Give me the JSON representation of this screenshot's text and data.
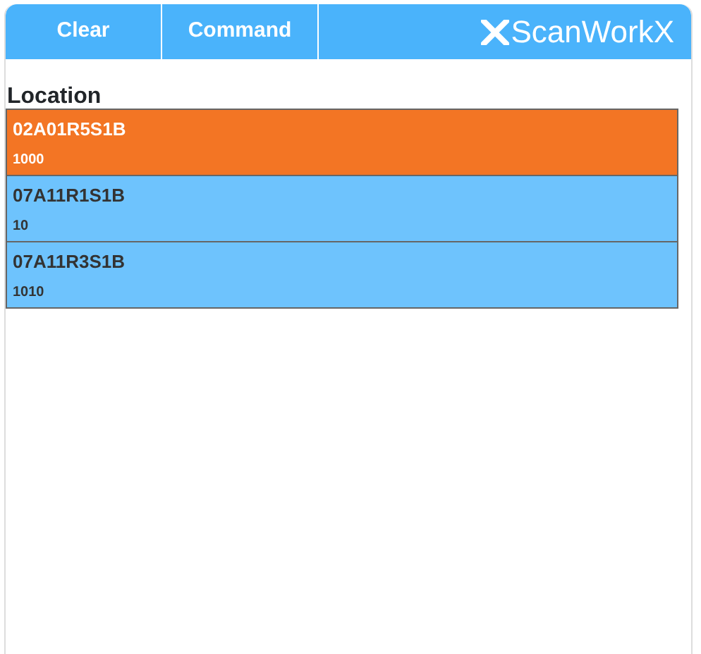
{
  "toolbar": {
    "buttons": [
      "Clear",
      "Command"
    ],
    "logo": "ScanWorkX"
  },
  "section_title": "Location",
  "locations": [
    {
      "code": "02A01R5S1B",
      "quantity": "1000",
      "selected": true
    },
    {
      "code": "07A11R1S1B",
      "quantity": "10",
      "selected": false
    },
    {
      "code": "07A11R3S1B",
      "quantity": "1010",
      "selected": false
    }
  ]
}
